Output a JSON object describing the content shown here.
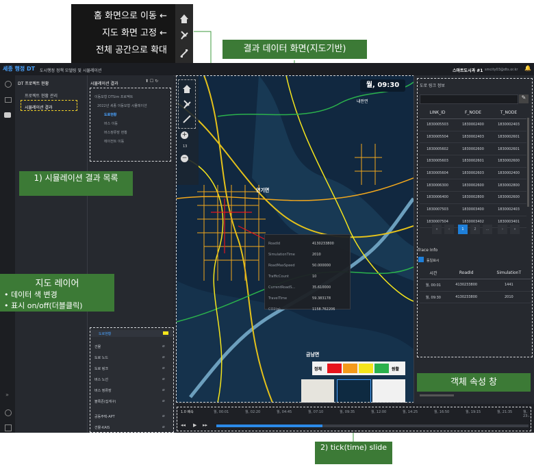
{
  "callouts": {
    "top_rows": [
      "홈 화면으로 이동 ←",
      "지도 화면 고정 ←",
      "전체 공간으로 확대"
    ],
    "map_screen": "결과 데이터 화면(지도기반)",
    "sim_list": "1) 시뮬레이션 결과 목록",
    "map_layer_title": "지도 레이어",
    "map_layer_lines": [
      "• 데이터 색 변경",
      "• 표시 on/off(더블클릭)"
    ],
    "object_attr": "객체 속성 창",
    "tick_slide": "2) tick(time) slide"
  },
  "app": {
    "logo": "세종 행정 DT",
    "subtitle": "도시행정 정책 모델링 및 시뮬레이션",
    "user": "스마트도시과 #1",
    "email": "smcity03@dts.or.kr"
  },
  "tree": {
    "header": "DT 프로젝트 현황",
    "items": [
      "프로젝트 현황 관리",
      "시뮬레이션 결과"
    ]
  },
  "results": {
    "header": "시뮬레이션 결과",
    "items": [
      "이동모형 DTSim 프로젝트",
      "2022년 세종 이동모형 시뮬레이션",
      "도로현황",
      "버스 이동",
      "버스정류장 현황",
      "에이전트 이동"
    ]
  },
  "layers": {
    "header": "도로현황",
    "items": [
      "건물",
      "도로 노드",
      "도로 링크",
      "버스 노선",
      "버스 정류장",
      "블록존(집계구)",
      "공동주택-APT",
      "건물-KAIS"
    ]
  },
  "map": {
    "time": "월, 09:30",
    "zoom": "13",
    "place_1": "연기면",
    "place_2": "금남면",
    "place_3": "내판면",
    "popup": [
      [
        "RoadId",
        "4130233800"
      ],
      [
        "SimulationTime",
        "2010"
      ],
      [
        "RoadMaxSpeed",
        "50.000000"
      ],
      [
        "TrafficCount",
        "10"
      ],
      [
        "CurrentRoadS...",
        "35.610000"
      ],
      [
        "TravelTime",
        "59.383178"
      ],
      [
        "CO2(g)",
        "1158.762206"
      ]
    ],
    "legend_left": "정체",
    "legend_right": "원활",
    "legend_colors": [
      "#e8141c",
      "#f39a1a",
      "#f5e51c",
      "#2bb24c"
    ]
  },
  "right": {
    "header": "도로 링크 정보",
    "columns": [
      "LINK_ID",
      "F_NODE",
      "T_NODE"
    ],
    "rows": [
      [
        "1830005503",
        "1830002400",
        "1830002403"
      ],
      [
        "1830005504",
        "1830002403",
        "1830002601"
      ],
      [
        "1830005602",
        "1830002600",
        "1830002601"
      ],
      [
        "1830005603",
        "1830002601",
        "1830002600"
      ],
      [
        "1830005604",
        "1830002603",
        "1830002400"
      ],
      [
        "1830006300",
        "1830002600",
        "1830002800"
      ],
      [
        "1830006400",
        "1830002800",
        "1830002600"
      ],
      [
        "1830007503",
        "1830003400",
        "1830002403"
      ],
      [
        "1830007504",
        "1830003402",
        "1830003401"
      ]
    ],
    "pages": [
      "«",
      "‹",
      "1",
      "2",
      "...",
      "›",
      "»"
    ],
    "trace_title": "Trace Info",
    "trace_check": "동일표시",
    "trace_columns": [
      "시간",
      "RoadId",
      "SimulationT"
    ],
    "trace_rows": [
      [
        "월, 00:01",
        "4130233800",
        "1441"
      ],
      [
        "월, 09:30",
        "4130233800",
        "2010"
      ]
    ]
  },
  "timeline": {
    "ticks": [
      "1.0 배속",
      "월, 00:01",
      "월, 02:20",
      "월, 04:45",
      "월, 07:10",
      "월, 09:35",
      "월, 12:00",
      "월, 14:25",
      "월, 16:50",
      "월, 19:15",
      "월, 21:35",
      "월, 23:..."
    ],
    "progress": 0.34
  }
}
